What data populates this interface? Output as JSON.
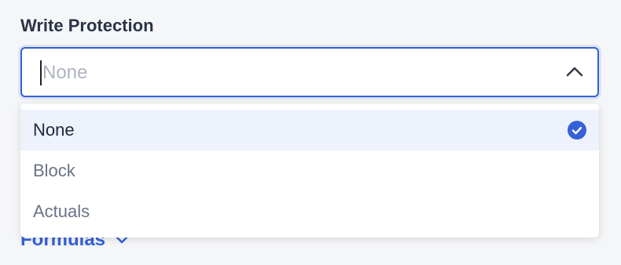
{
  "field": {
    "label": "Write Protection",
    "value": "",
    "placeholder": "None"
  },
  "dropdown": {
    "options": [
      {
        "label": "None",
        "selected": true
      },
      {
        "label": "Block",
        "selected": false
      },
      {
        "label": "Actuals",
        "selected": false
      }
    ]
  },
  "formulas_link": {
    "label": "Formulas"
  },
  "colors": {
    "accent": "#3461d8",
    "selected_row": "#eef2fc",
    "text": "#2b3345",
    "muted_text": "#6a7386"
  },
  "icons": {
    "select_toggle": "chevron-up-icon",
    "selected_indicator": "check-circle-icon",
    "formulas_toggle": "chevron-down-icon"
  }
}
